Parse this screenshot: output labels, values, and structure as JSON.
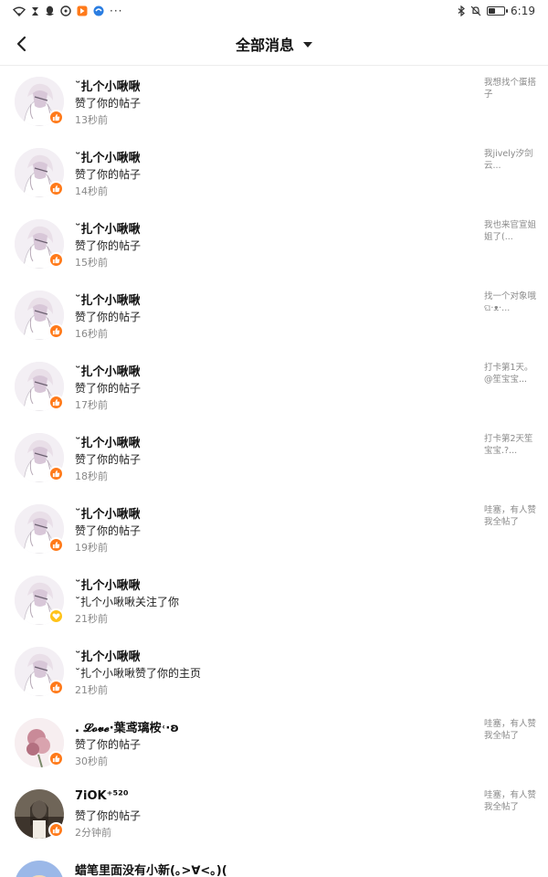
{
  "status_bar": {
    "time": "6:19",
    "left_icons": [
      "wifi-icon",
      "hourglass-icon",
      "qq-icon",
      "message-icon",
      "app-orange-icon",
      "app-blue-icon"
    ],
    "right_icons": [
      "bluetooth-icon",
      "mute-bell-icon",
      "battery-icon"
    ],
    "overflow": "···",
    "battery_level": 0.45
  },
  "header": {
    "title": "全部消息"
  },
  "colors": {
    "like_badge": "#ff7a1a",
    "follow_badge": "#ffc31a"
  },
  "messages": [
    {
      "name": "˘扎个小啾啾",
      "action": "赞了你的帖子",
      "time": "13秒前",
      "preview": "我想找个蛋搭子",
      "badge": "like"
    },
    {
      "name": "˘扎个小啾啾",
      "action": "赞了你的帖子",
      "time": "14秒前",
      "preview": "我jively汐剑云...",
      "badge": "like"
    },
    {
      "name": "˘扎个小啾啾",
      "action": "赞了你的帖子",
      "time": "15秒前",
      "preview": "我也来官宣姐姐了(...",
      "badge": "like"
    },
    {
      "name": "˘扎个小啾啾",
      "action": "赞了你的帖子",
      "time": "16秒前",
      "preview": "找一个对象哦ଘ·ᴥ·...",
      "badge": "like"
    },
    {
      "name": "˘扎个小啾啾",
      "action": "赞了你的帖子",
      "time": "17秒前",
      "preview": "打卡第1天。@笙宝宝...",
      "badge": "like"
    },
    {
      "name": "˘扎个小啾啾",
      "action": "赞了你的帖子",
      "time": "18秒前",
      "preview": "打卡第2天笙宝宝.?...",
      "badge": "like"
    },
    {
      "name": "˘扎个小啾啾",
      "action": "赞了你的帖子",
      "time": "19秒前",
      "preview": "哇塞，有人赞我全帖了",
      "badge": "like"
    },
    {
      "name": "˘扎个小啾啾",
      "action": "˘扎个小啾啾关注了你",
      "time": "21秒前",
      "preview": "",
      "badge": "follow"
    },
    {
      "name": "˘扎个小啾啾",
      "action": "˘扎个小啾啾赞了你的主页",
      "time": "21秒前",
      "preview": "",
      "badge": "like"
    },
    {
      "name": ". 𝓛𝓸𝓿𝓮·葉鸢璃桉˓·ʚ",
      "action": "赞了你的帖子",
      "time": "30秒前",
      "preview": "哇塞，有人赞我全帖了",
      "badge": "like"
    },
    {
      "name": "7iOK⁺⁵²⁰",
      "action": "赞了你的帖子",
      "time": "2分钟前",
      "preview": "哇塞，有人赞我全帖了",
      "badge": "like"
    },
    {
      "name": "蜡笔里面没有小新(｡>∀<｡)(",
      "action": "",
      "time": "",
      "preview": "",
      "badge": "none"
    }
  ]
}
